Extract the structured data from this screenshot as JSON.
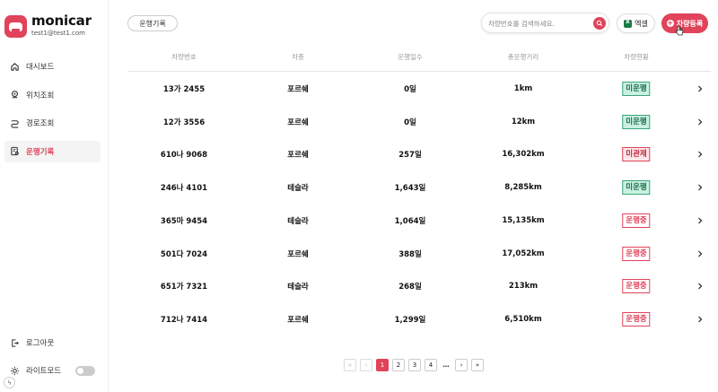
{
  "brand": {
    "name": "monicar",
    "email": "test1@test1.com"
  },
  "nav": [
    {
      "label": "대시보드",
      "icon": "home-icon",
      "active": false
    },
    {
      "label": "위치조회",
      "icon": "location-icon",
      "active": false
    },
    {
      "label": "경로조회",
      "icon": "route-icon",
      "active": false
    },
    {
      "label": "운행기록",
      "icon": "record-icon",
      "active": true
    }
  ],
  "bottom_nav": {
    "logout": "로그아웃",
    "lightmode": "라이트모드"
  },
  "topbar": {
    "tab": "운행기록",
    "search_placeholder": "차량번호를 검색하세요.",
    "excel": "엑셀",
    "add": "차량등록"
  },
  "table": {
    "headers": [
      "차량번호",
      "차종",
      "운행일수",
      "총운행거리",
      "차량현황"
    ],
    "rows": [
      {
        "plate": "13가 2455",
        "model": "포르쉐",
        "days": "0일",
        "distance": "1km",
        "status": "미운행"
      },
      {
        "plate": "12가 3556",
        "model": "포르쉐",
        "days": "0일",
        "distance": "12km",
        "status": "미운행"
      },
      {
        "plate": "610나 9068",
        "model": "포르쉐",
        "days": "257일",
        "distance": "16,302km",
        "status": "미관제"
      },
      {
        "plate": "246나 4101",
        "model": "테슬라",
        "days": "1,643일",
        "distance": "8,285km",
        "status": "미운행"
      },
      {
        "plate": "365마 9454",
        "model": "테슬라",
        "days": "1,064일",
        "distance": "15,135km",
        "status": "운행중"
      },
      {
        "plate": "501다 7024",
        "model": "포르쉐",
        "days": "388일",
        "distance": "17,052km",
        "status": "운행중"
      },
      {
        "plate": "651가 7321",
        "model": "테슬라",
        "days": "268일",
        "distance": "213km",
        "status": "운행중"
      },
      {
        "plate": "712나 7414",
        "model": "포르쉐",
        "days": "1,299일",
        "distance": "6,510km",
        "status": "운행중"
      }
    ]
  },
  "status_colors": {
    "미운행": {
      "bg": "#c9f1e0",
      "border": "#3aa57a",
      "text": "#1e6e4e"
    },
    "미관제": {
      "bg": "#fde6e9",
      "border": "#e0435a",
      "text": "#c0283f"
    },
    "운행중": {
      "bg": "#ffffff",
      "border": "#e0435a",
      "text": "#e0435a"
    }
  },
  "pagination": {
    "first": "«",
    "prev": "‹",
    "pages": [
      "1",
      "2",
      "3",
      "4"
    ],
    "current": "1",
    "ellipsis": "…",
    "next": "›",
    "last": "»"
  },
  "colors": {
    "accent": "#e0435a"
  }
}
